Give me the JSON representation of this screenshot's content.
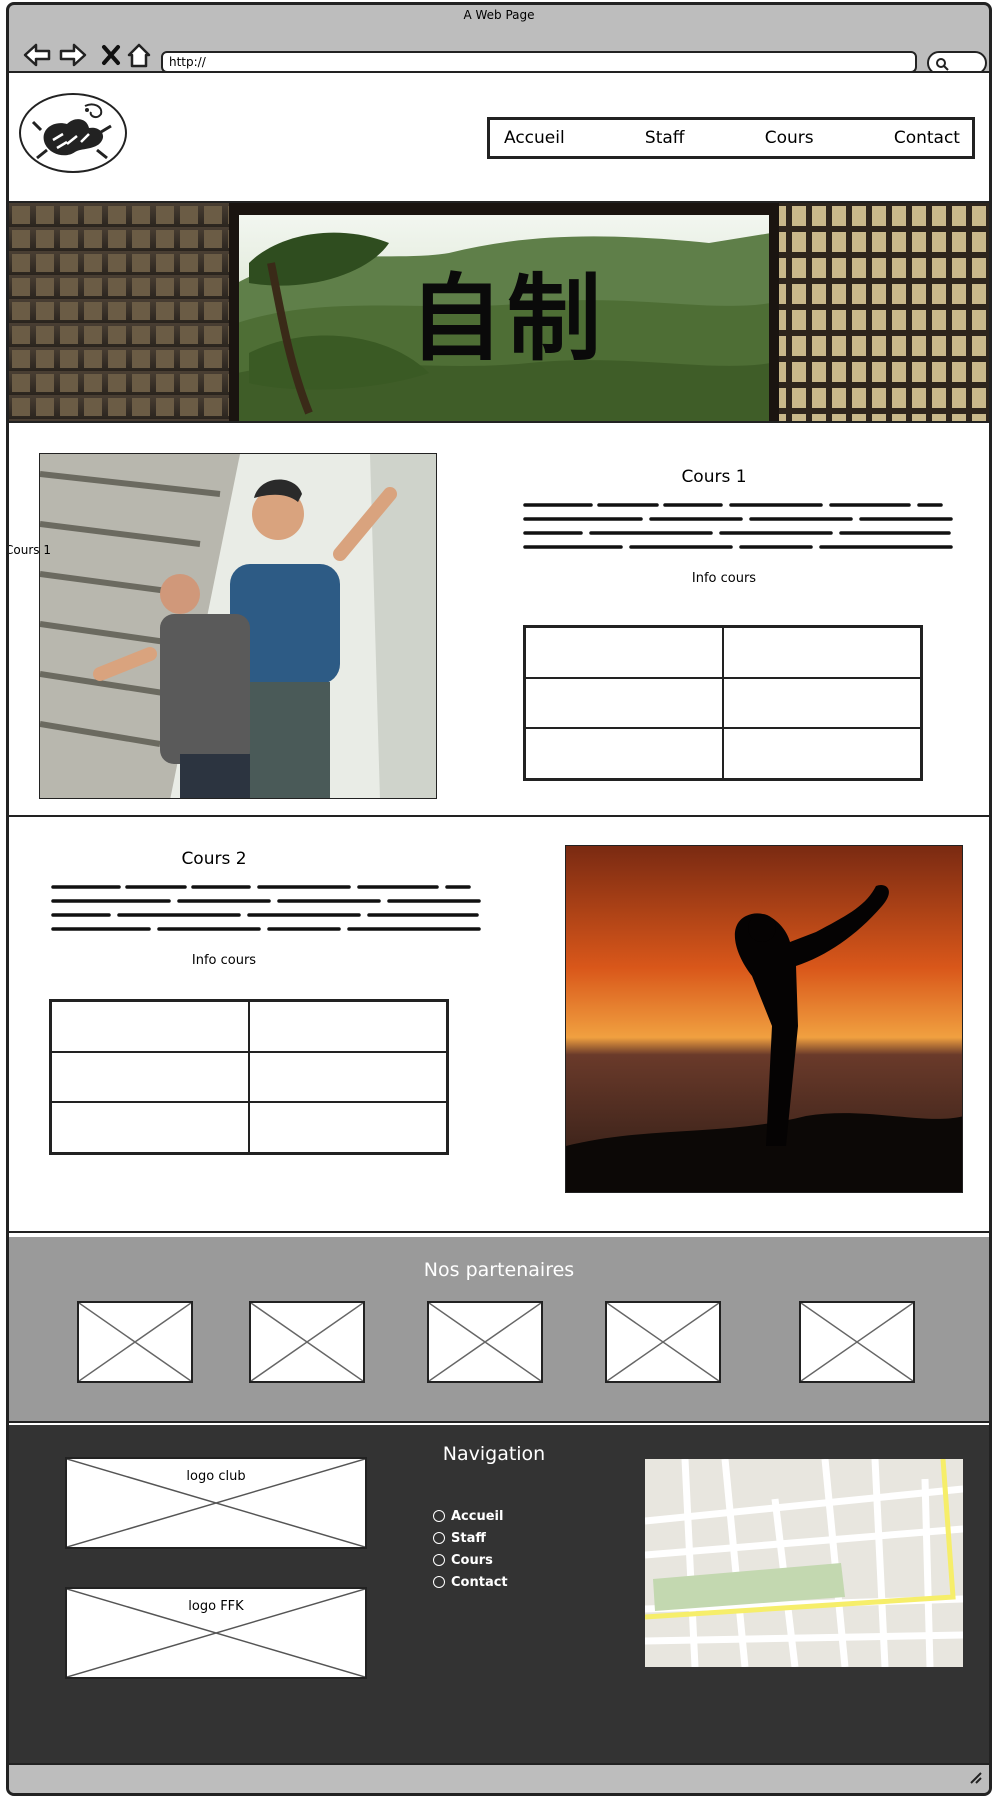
{
  "window": {
    "title": "A Web Page",
    "url": "http://"
  },
  "nav": {
    "items": [
      "Accueil",
      "Staff",
      "Cours",
      "Contact"
    ]
  },
  "hero": {
    "kanji": "自制"
  },
  "cours1": {
    "title": "Cours 1",
    "info": "Info cours",
    "side_label": "Cours 1"
  },
  "cours2": {
    "title": "Cours 2",
    "info": "Info cours"
  },
  "partners": {
    "title": "Nos partenaires"
  },
  "footer": {
    "nav_title": "Navigation",
    "logo_club": "logo club",
    "logo_ffk": "logo FFK",
    "links": [
      "Accueil",
      "Staff",
      "Cours",
      "Contact"
    ]
  },
  "icons": [
    "back-arrow-icon",
    "forward-arrow-icon",
    "close-icon",
    "home-icon",
    "search-icon",
    "resize-grip-icon"
  ],
  "colors": {
    "partners_bg": "#9a9a9a",
    "footer_bg": "#333333",
    "map_road_yellow": "#f6ee6a",
    "map_park": "#c3d8b0"
  }
}
